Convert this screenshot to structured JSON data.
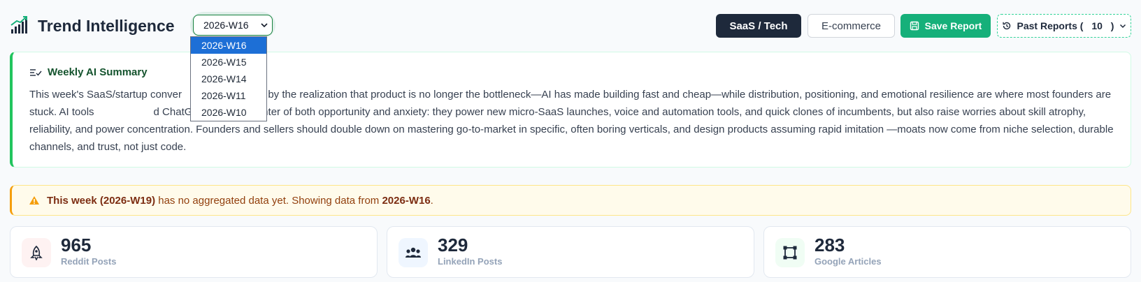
{
  "header": {
    "title": "Trend Intelligence",
    "logo_icon": "chart-trend-icon",
    "week_select": {
      "value": "2026-W16"
    },
    "buttons": {
      "saas": "SaaS / Tech",
      "ecommerce": "E-commerce",
      "save": "Save Report",
      "past_reports_prefix": "Past Reports (",
      "past_reports_count": "10",
      "past_reports_suffix": ")"
    }
  },
  "dropdown": {
    "options": [
      "2026-W16",
      "2026-W15",
      "2026-W14",
      "2026-W11",
      "2026-W10"
    ],
    "selected": "2026-W16"
  },
  "summary": {
    "title": "Weekly AI Summary",
    "text_visible_start": "This week's SaaS/startup conver",
    "text_visible_rest": "ated by the realization that product is no longer the bottleneck—AI has made building fast and cheap—while distribution, positioning, and emotional resilience are where most founders are stuck. AI tools",
    "text_hidden_gap": "",
    "text_after_gap": "d ChatGPT sit at the center of both opportunity and anxiety: they power new micro-SaaS launches, voice and automation tools, and quick clones of incumbents, but also raise worries about skill atrophy, reliability, and power concentration. Founders and sellers should double down on mastering go-to-market in specific, often boring verticals, and design products assuming rapid imitation —moats now come from niche selection, durable channels, and trust, not just code."
  },
  "alert": {
    "bold_prefix": "This week (2026-W19)",
    "middle": " has no aggregated data yet. Showing data from ",
    "bold_week": "2026-W16",
    "suffix": "."
  },
  "stats": [
    {
      "value": "965",
      "label": "Reddit Posts",
      "icon": "reddit-icon"
    },
    {
      "value": "329",
      "label": "LinkedIn Posts",
      "icon": "people-group-icon"
    },
    {
      "value": "283",
      "label": "Google Articles",
      "icon": "vector-square-icon"
    }
  ],
  "colors": {
    "primary_dark": "#1e293b",
    "accent_green": "#16b07a",
    "warning": "#f59e0b"
  }
}
